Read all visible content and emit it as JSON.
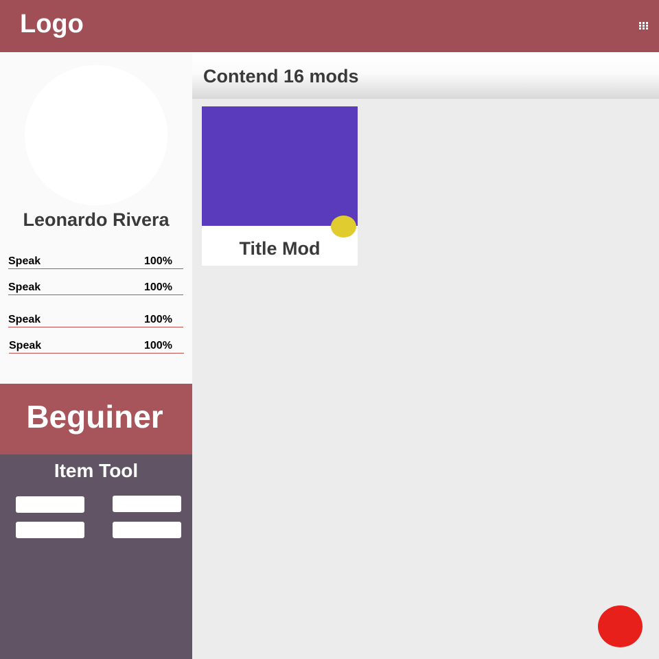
{
  "header": {
    "logo_text": "Logo",
    "menu_icon": "grid-menu-icon",
    "background_color": "#a14f56"
  },
  "sidebar": {
    "avatar_icon": "avatar",
    "profile_name": "Leonardo Rivera",
    "stats": [
      {
        "label": "Speak",
        "value": "100%"
      },
      {
        "label": "Speak",
        "value": "100%"
      },
      {
        "label": "Speak",
        "value": "100%"
      },
      {
        "label": "Speak",
        "value": "100%"
      }
    ],
    "level_label": "Beguiner",
    "level_color": "#a8545b",
    "tools": {
      "title": "Item Tool",
      "panel_color": "#615464",
      "slots": [
        "",
        "",
        "",
        ""
      ]
    }
  },
  "main": {
    "title": "Contend 16 mods",
    "cards": [
      {
        "title": "Title Mod",
        "thumbnail_color": "#5a3bbb",
        "badge_color": "#e0cc2e"
      }
    ]
  },
  "fab": {
    "color": "#e8201c"
  }
}
